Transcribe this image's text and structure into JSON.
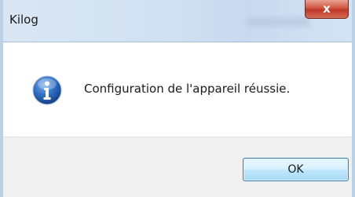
{
  "window": {
    "title": "Kilog",
    "close_label": "x"
  },
  "dialog": {
    "icon": "information-icon",
    "message": "Configuration de l'appareil réussie."
  },
  "buttons": {
    "ok_label": "OK"
  },
  "colors": {
    "titlebar": "#d2e1f1",
    "close_button": "#c7442f",
    "footer": "#f0f0f0",
    "ok_border": "#3c7fb1",
    "info_icon": "#1f5fb4"
  }
}
